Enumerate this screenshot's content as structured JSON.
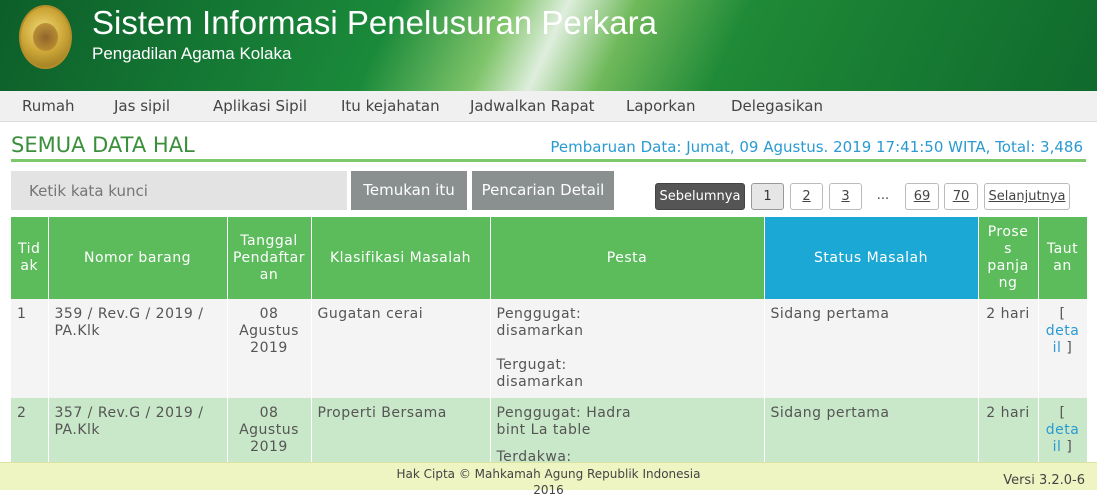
{
  "header": {
    "title": "Sistem Informasi Penelusuran Perkara",
    "subtitle": "Pengadilan Agama Kolaka"
  },
  "nav": {
    "items": [
      "Rumah",
      "Jas sipil",
      "Aplikasi Sipil",
      "Itu kejahatan",
      "Jadwalkan Rapat",
      "Laporkan",
      "Delegasikan"
    ]
  },
  "section": {
    "title": "SEMUA DATA HAL",
    "update_info": "Pembaruan Data: Jumat, 09 Agustus. 2019 17:41:50 WITA, Total: 3,486"
  },
  "search": {
    "placeholder": "Ketik kata kunci",
    "find_label": "Temukan itu",
    "detail_search_label": "Pencarian Detail"
  },
  "pagination": {
    "previous": "Sebelumnya",
    "pages": [
      "1",
      "2",
      "3"
    ],
    "ellipsis": "...",
    "last_pages": [
      "69",
      "70"
    ],
    "next": "Selanjutnya",
    "current": "1"
  },
  "table": {
    "headers": [
      "Tid ak",
      "Nomor barang",
      "Tanggal Pendaftar an",
      "Klasifikasi Masalah",
      "Pesta",
      "Status Masalah",
      "Prose s panja ng",
      "Taut an"
    ],
    "rows": [
      {
        "no": "1",
        "case_number": "359 / Rev.G / 2019 / PA.Klk",
        "date": "08 Agustus 2019",
        "classification": "Gugatan cerai",
        "party_plaintiff": "Penggugat: disamarkan",
        "party_defendant": "Tergugat: disamarkan",
        "status": "Sidang pertama",
        "duration": "2 hari",
        "link_open": "[",
        "link_text": "deta il",
        "link_close": "]"
      },
      {
        "no": "2",
        "case_number": "357 / Rev.G / 2019 / PA.Klk",
        "date": "08 Agustus 2019",
        "classification": "Properti Bersama",
        "party_plaintiff": "Penggugat: Hadra bint La table",
        "party_defendant": "Terdakwa:",
        "status": "Sidang pertama",
        "duration": "2 hari",
        "link_open": "[",
        "link_text": "deta il",
        "link_close": "]"
      }
    ]
  },
  "footer": {
    "copyright": "Hak Cipta © Mahkamah Agung Republik Indonesia 2016",
    "version": "Versi 3.2.0-6"
  },
  "colors": {
    "header_green": "#1a8a3a",
    "table_header_green": "#5cbc5c",
    "status_header_blue": "#1ba8d5",
    "link_blue": "#2a9ad0",
    "footer_bg": "#eef5c2"
  }
}
